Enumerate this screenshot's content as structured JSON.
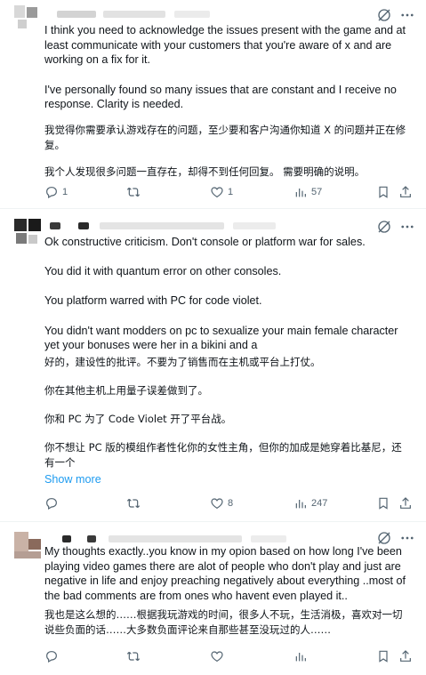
{
  "tweets": [
    {
      "paragraphs": [
        "I think you need to acknowledge the issues present with the game and at least communicate with your customers that you're aware of x and are working on a fix for it.",
        "I've personally found so many issues that are constant and I receive no response.  Clarity is needed.",
        "我觉得你需要承认游戏存在的问题，至少要和客户沟通你知道 X 的问题并正在修复。",
        "我个人发现很多问题一直存在，却得不到任何回复。 需要明确的说明。"
      ],
      "actions": {
        "replies": "1",
        "reposts": "",
        "likes": "1",
        "views": "57"
      }
    },
    {
      "paragraphs": [
        "Ok constructive criticism. Don't console or platform war for sales.",
        "You did it with quantum error on other consoles.",
        "You platform warred with PC for code violet.",
        "You didn't want modders on pc to sexualize your main female character yet your bonuses were her in a bikini and a",
        "好的，建设性的批评。不要为了销售而在主机或平台上打仗。",
        "你在其他主机上用量子误差做到了。",
        "你和 PC 为了 Code Violet 开了平台战。",
        "你不想让 PC 版的模组作者性化你的女性主角，但你的加成是她穿着比基尼，还有一个"
      ],
      "show_more": "Show more",
      "actions": {
        "replies": "",
        "reposts": "",
        "likes": "8",
        "views": "247"
      }
    },
    {
      "paragraphs": [
        "My thoughts exactly..you know in my opion based on how long I've been playing video games there are alot of people who don't play and just are negative in life and enjoy preaching negatively about everything ..most of the bad comments are from ones who havent even played it..",
        "我也是这么想的……根据我玩游戏的时间，很多人不玩，生活消极，喜欢对一切说些负面的话……大多数负面评论来自那些甚至没玩过的人……"
      ],
      "actions": {
        "replies": "",
        "reposts": "",
        "likes": "",
        "views": ""
      }
    }
  ],
  "icons": [
    "reply-icon",
    "repost-icon",
    "like-icon",
    "views-icon",
    "bookmark-icon",
    "share-icon",
    "grok-icon",
    "more-icon"
  ],
  "colors": {
    "text": "#0f1419",
    "muted": "#536471",
    "link": "#1d9bf0",
    "divider": "#eff3f4"
  }
}
